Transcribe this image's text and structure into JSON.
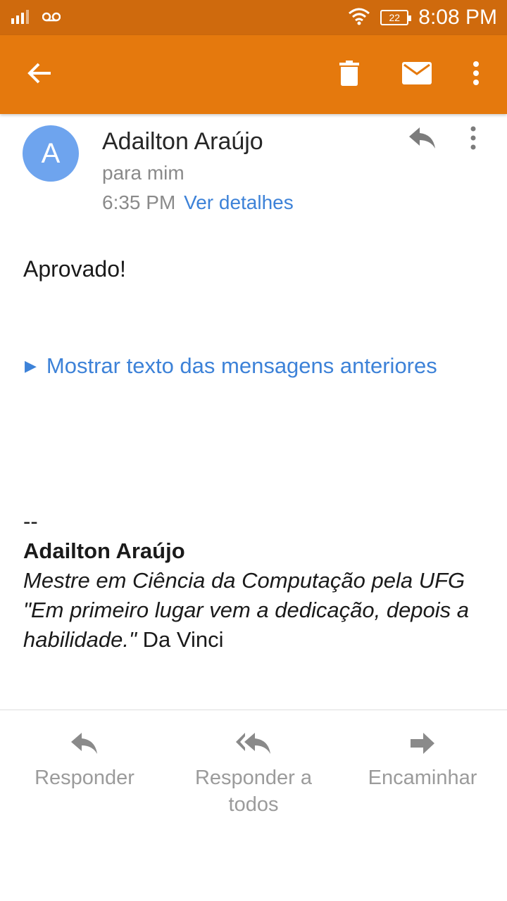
{
  "status_bar": {
    "time": "8:08 PM",
    "battery_level": "22",
    "icons": [
      "signal-icon",
      "voicemail-icon",
      "wifi-icon",
      "battery-icon"
    ]
  },
  "app_bar": {
    "color": "#e5790d",
    "icons": [
      "back-arrow-icon",
      "trash-icon",
      "mail-icon",
      "more-vert-icon"
    ]
  },
  "message": {
    "avatar_letter": "A",
    "avatar_color": "#6ea4ee",
    "sender": "Adailton Araújo",
    "recipient": "para mim",
    "time": "6:35 PM",
    "details_link": "Ver detalhes",
    "body": "Aprovado!",
    "show_quoted": "Mostrar texto das mensagens anteriores",
    "link_color": "#3d82d8"
  },
  "signature": {
    "separator": "--",
    "name": "Adailton Araújo",
    "title": "Mestre em Ciência da Computação pela UFG",
    "quote": "\"Em primeiro lugar vem a dedicação, depois a habilidade.\"",
    "quote_author": "Da Vinci"
  },
  "actions": {
    "reply": "Responder",
    "reply_all": "Responder a todos",
    "forward": "Encaminhar"
  }
}
